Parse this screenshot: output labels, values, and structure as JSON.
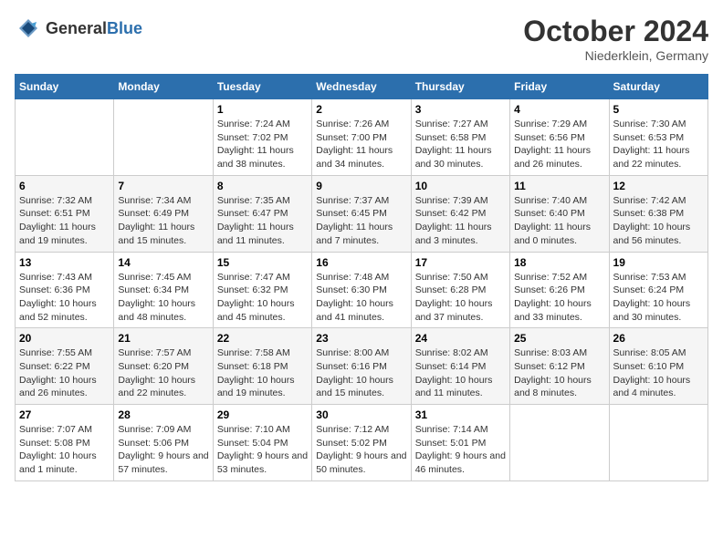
{
  "header": {
    "logo_general": "General",
    "logo_blue": "Blue",
    "month_year": "October 2024",
    "location": "Niederklein, Germany"
  },
  "weekdays": [
    "Sunday",
    "Monday",
    "Tuesday",
    "Wednesday",
    "Thursday",
    "Friday",
    "Saturday"
  ],
  "weeks": [
    [
      {
        "day": "",
        "detail": ""
      },
      {
        "day": "",
        "detail": ""
      },
      {
        "day": "1",
        "detail": "Sunrise: 7:24 AM\nSunset: 7:02 PM\nDaylight: 11 hours and 38 minutes."
      },
      {
        "day": "2",
        "detail": "Sunrise: 7:26 AM\nSunset: 7:00 PM\nDaylight: 11 hours and 34 minutes."
      },
      {
        "day": "3",
        "detail": "Sunrise: 7:27 AM\nSunset: 6:58 PM\nDaylight: 11 hours and 30 minutes."
      },
      {
        "day": "4",
        "detail": "Sunrise: 7:29 AM\nSunset: 6:56 PM\nDaylight: 11 hours and 26 minutes."
      },
      {
        "day": "5",
        "detail": "Sunrise: 7:30 AM\nSunset: 6:53 PM\nDaylight: 11 hours and 22 minutes."
      }
    ],
    [
      {
        "day": "6",
        "detail": "Sunrise: 7:32 AM\nSunset: 6:51 PM\nDaylight: 11 hours and 19 minutes."
      },
      {
        "day": "7",
        "detail": "Sunrise: 7:34 AM\nSunset: 6:49 PM\nDaylight: 11 hours and 15 minutes."
      },
      {
        "day": "8",
        "detail": "Sunrise: 7:35 AM\nSunset: 6:47 PM\nDaylight: 11 hours and 11 minutes."
      },
      {
        "day": "9",
        "detail": "Sunrise: 7:37 AM\nSunset: 6:45 PM\nDaylight: 11 hours and 7 minutes."
      },
      {
        "day": "10",
        "detail": "Sunrise: 7:39 AM\nSunset: 6:42 PM\nDaylight: 11 hours and 3 minutes."
      },
      {
        "day": "11",
        "detail": "Sunrise: 7:40 AM\nSunset: 6:40 PM\nDaylight: 11 hours and 0 minutes."
      },
      {
        "day": "12",
        "detail": "Sunrise: 7:42 AM\nSunset: 6:38 PM\nDaylight: 10 hours and 56 minutes."
      }
    ],
    [
      {
        "day": "13",
        "detail": "Sunrise: 7:43 AM\nSunset: 6:36 PM\nDaylight: 10 hours and 52 minutes."
      },
      {
        "day": "14",
        "detail": "Sunrise: 7:45 AM\nSunset: 6:34 PM\nDaylight: 10 hours and 48 minutes."
      },
      {
        "day": "15",
        "detail": "Sunrise: 7:47 AM\nSunset: 6:32 PM\nDaylight: 10 hours and 45 minutes."
      },
      {
        "day": "16",
        "detail": "Sunrise: 7:48 AM\nSunset: 6:30 PM\nDaylight: 10 hours and 41 minutes."
      },
      {
        "day": "17",
        "detail": "Sunrise: 7:50 AM\nSunset: 6:28 PM\nDaylight: 10 hours and 37 minutes."
      },
      {
        "day": "18",
        "detail": "Sunrise: 7:52 AM\nSunset: 6:26 PM\nDaylight: 10 hours and 33 minutes."
      },
      {
        "day": "19",
        "detail": "Sunrise: 7:53 AM\nSunset: 6:24 PM\nDaylight: 10 hours and 30 minutes."
      }
    ],
    [
      {
        "day": "20",
        "detail": "Sunrise: 7:55 AM\nSunset: 6:22 PM\nDaylight: 10 hours and 26 minutes."
      },
      {
        "day": "21",
        "detail": "Sunrise: 7:57 AM\nSunset: 6:20 PM\nDaylight: 10 hours and 22 minutes."
      },
      {
        "day": "22",
        "detail": "Sunrise: 7:58 AM\nSunset: 6:18 PM\nDaylight: 10 hours and 19 minutes."
      },
      {
        "day": "23",
        "detail": "Sunrise: 8:00 AM\nSunset: 6:16 PM\nDaylight: 10 hours and 15 minutes."
      },
      {
        "day": "24",
        "detail": "Sunrise: 8:02 AM\nSunset: 6:14 PM\nDaylight: 10 hours and 11 minutes."
      },
      {
        "day": "25",
        "detail": "Sunrise: 8:03 AM\nSunset: 6:12 PM\nDaylight: 10 hours and 8 minutes."
      },
      {
        "day": "26",
        "detail": "Sunrise: 8:05 AM\nSunset: 6:10 PM\nDaylight: 10 hours and 4 minutes."
      }
    ],
    [
      {
        "day": "27",
        "detail": "Sunrise: 7:07 AM\nSunset: 5:08 PM\nDaylight: 10 hours and 1 minute."
      },
      {
        "day": "28",
        "detail": "Sunrise: 7:09 AM\nSunset: 5:06 PM\nDaylight: 9 hours and 57 minutes."
      },
      {
        "day": "29",
        "detail": "Sunrise: 7:10 AM\nSunset: 5:04 PM\nDaylight: 9 hours and 53 minutes."
      },
      {
        "day": "30",
        "detail": "Sunrise: 7:12 AM\nSunset: 5:02 PM\nDaylight: 9 hours and 50 minutes."
      },
      {
        "day": "31",
        "detail": "Sunrise: 7:14 AM\nSunset: 5:01 PM\nDaylight: 9 hours and 46 minutes."
      },
      {
        "day": "",
        "detail": ""
      },
      {
        "day": "",
        "detail": ""
      }
    ]
  ]
}
